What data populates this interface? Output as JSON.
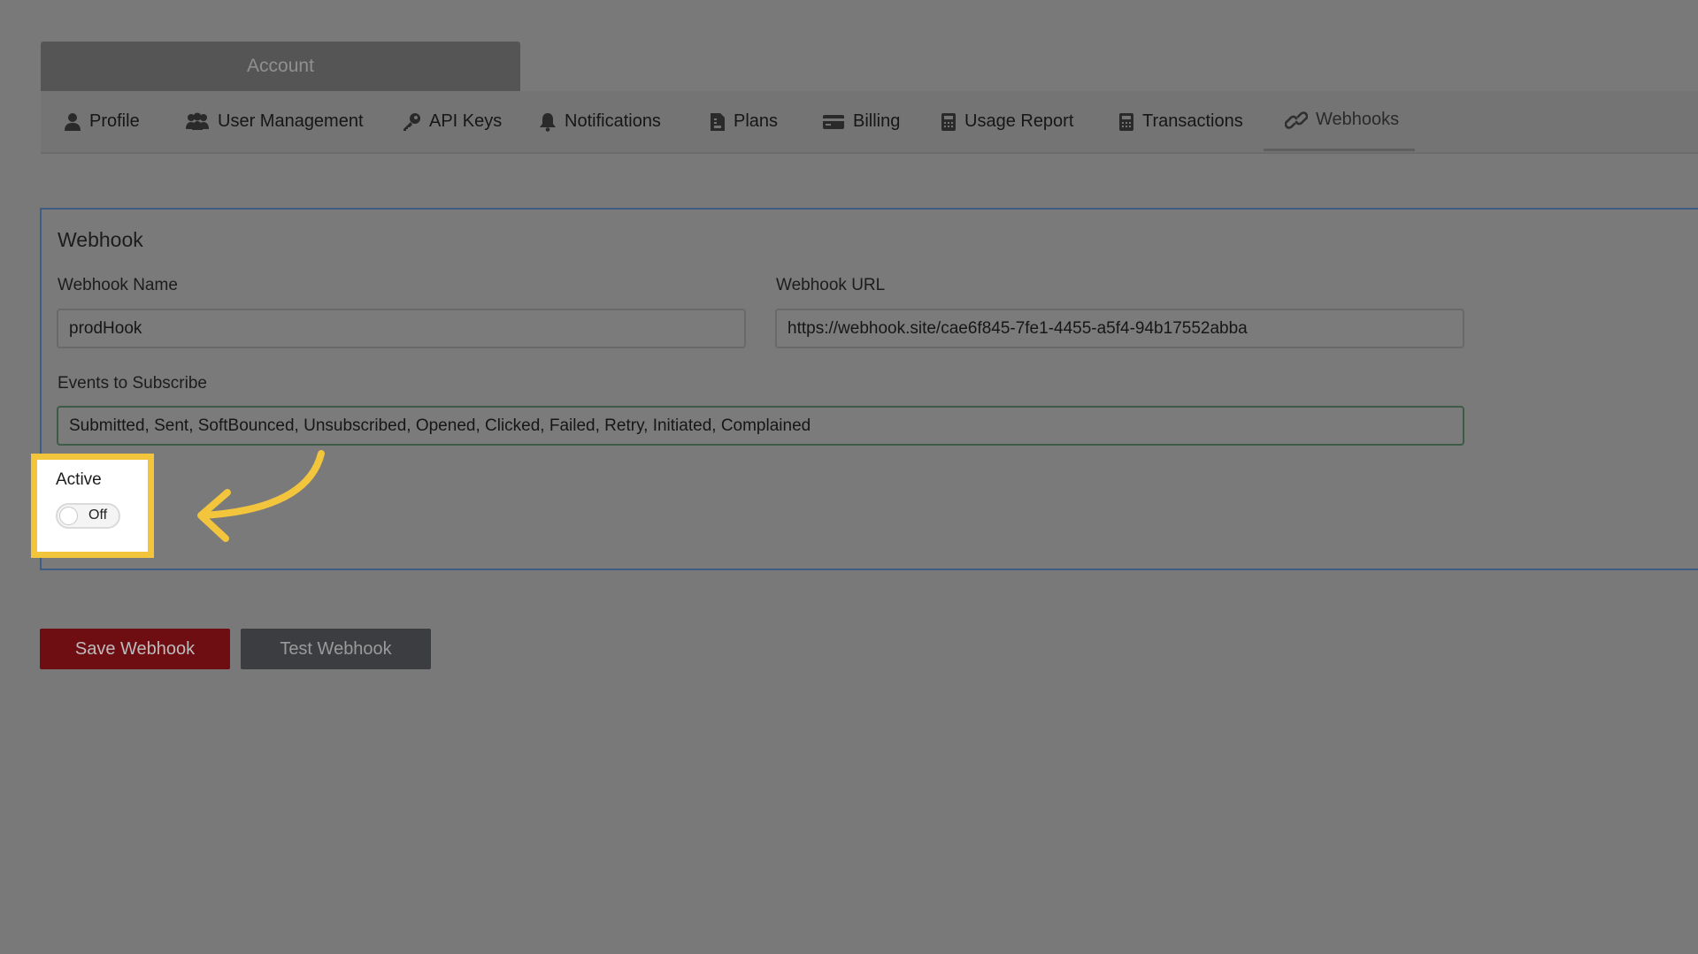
{
  "header": {
    "title": "Account"
  },
  "tabs": [
    {
      "label": "Profile",
      "icon": "person-icon"
    },
    {
      "label": "User Management",
      "icon": "users-icon"
    },
    {
      "label": "API Keys",
      "icon": "key-icon"
    },
    {
      "label": "Notifications",
      "icon": "bell-icon"
    },
    {
      "label": "Plans",
      "icon": "document-icon"
    },
    {
      "label": "Billing",
      "icon": "credit-card-icon"
    },
    {
      "label": "Usage Report",
      "icon": "calculator-icon"
    },
    {
      "label": "Transactions",
      "icon": "calculator-icon"
    },
    {
      "label": "Webhooks",
      "icon": "link-icon",
      "active": true
    }
  ],
  "panel": {
    "title": "Webhook",
    "name_label": "Webhook Name",
    "name_value": "prodHook",
    "url_label": "Webhook URL",
    "url_value": "https://webhook.site/cae6f845-7fe1-4455-a5f4-94b17552abba",
    "events_label": "Events to Subscribe",
    "events_value": "Submitted, Sent, SoftBounced, Unsubscribed, Opened, Clicked, Failed, Retry, Initiated, Complained",
    "active_label": "Active",
    "toggle_text": "Off",
    "toggle_state": "off"
  },
  "actions": {
    "save_label": "Save Webhook",
    "test_label": "Test Webhook"
  },
  "colors": {
    "highlight": "#f2c53d",
    "save_button": "#6e0d12",
    "panel_border": "#3e5d84"
  }
}
